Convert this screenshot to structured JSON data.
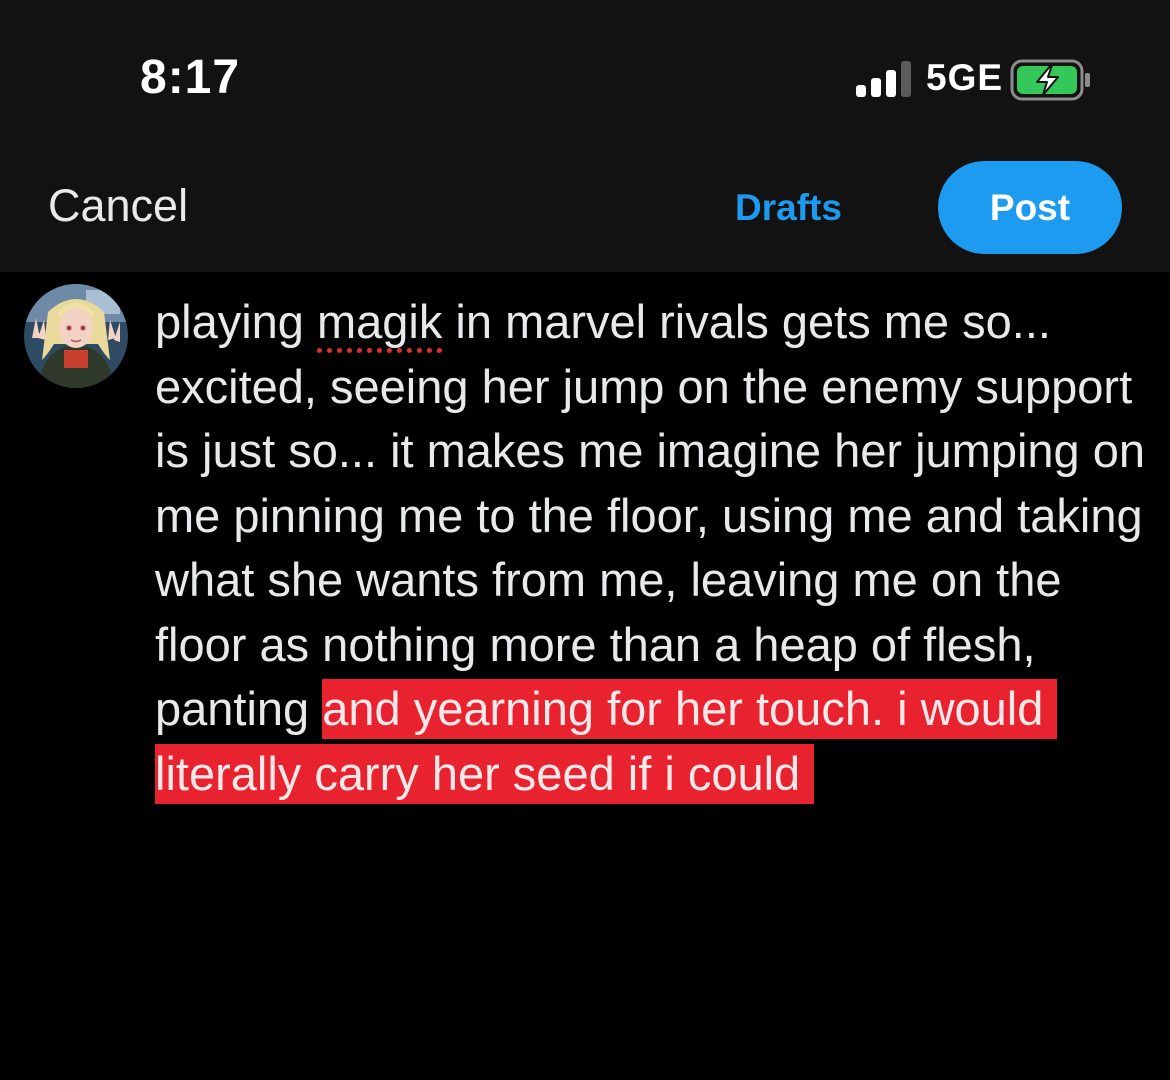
{
  "status_bar": {
    "time": "8:17",
    "network": "5GE",
    "signal_icon": "cellular-signal-icon",
    "battery_icon": "battery-charging-icon"
  },
  "header": {
    "cancel_label": "Cancel",
    "drafts_label": "Drafts",
    "post_label": "Post"
  },
  "composer": {
    "avatar": "user-avatar",
    "text_before": "playing ",
    "misspelled_word": "magik",
    "text_middle": " in marvel rivals gets me so... excited, seeing her jump on the enemy support is just so... it makes me imagine her jumping on me pinning me to the floor, using me and taking what she wants from me, leaving me on the floor as nothing more than a heap of flesh, panting ",
    "selected_text": "and yearning for her touch. i would literally carry her seed if i could"
  },
  "colors": {
    "background": "#000000",
    "bar_background": "#121212",
    "accent": "#1d9bf0",
    "selection": "#e8232f",
    "battery_green": "#34c759",
    "spellcheck_red": "#e0312f"
  }
}
